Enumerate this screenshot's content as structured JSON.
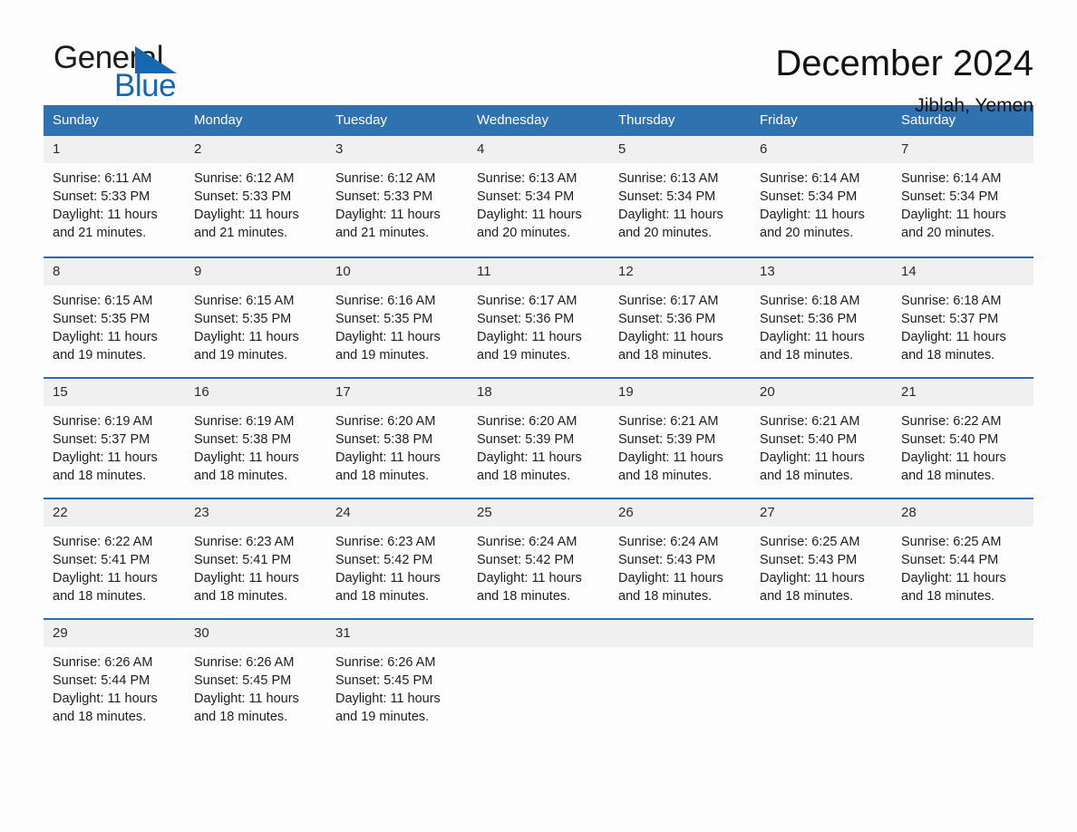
{
  "logo": {
    "word_one": "General",
    "word_two": "Blue",
    "accent_color": "#1668b3"
  },
  "header": {
    "month_title": "December 2024",
    "location": "Jiblah, Yemen",
    "header_bg_color": "#3071af",
    "row_divider_color": "#2a6cb0",
    "daynum_bg_color": "#f0f0f0"
  },
  "weekday_headers": [
    "Sunday",
    "Monday",
    "Tuesday",
    "Wednesday",
    "Thursday",
    "Friday",
    "Saturday"
  ],
  "weeks": [
    [
      {
        "day": "1",
        "sunrise": "Sunrise: 6:11 AM",
        "sunset": "Sunset: 5:33 PM",
        "daylight_line1": "Daylight: 11 hours",
        "daylight_line2": "and 21 minutes."
      },
      {
        "day": "2",
        "sunrise": "Sunrise: 6:12 AM",
        "sunset": "Sunset: 5:33 PM",
        "daylight_line1": "Daylight: 11 hours",
        "daylight_line2": "and 21 minutes."
      },
      {
        "day": "3",
        "sunrise": "Sunrise: 6:12 AM",
        "sunset": "Sunset: 5:33 PM",
        "daylight_line1": "Daylight: 11 hours",
        "daylight_line2": "and 21 minutes."
      },
      {
        "day": "4",
        "sunrise": "Sunrise: 6:13 AM",
        "sunset": "Sunset: 5:34 PM",
        "daylight_line1": "Daylight: 11 hours",
        "daylight_line2": "and 20 minutes."
      },
      {
        "day": "5",
        "sunrise": "Sunrise: 6:13 AM",
        "sunset": "Sunset: 5:34 PM",
        "daylight_line1": "Daylight: 11 hours",
        "daylight_line2": "and 20 minutes."
      },
      {
        "day": "6",
        "sunrise": "Sunrise: 6:14 AM",
        "sunset": "Sunset: 5:34 PM",
        "daylight_line1": "Daylight: 11 hours",
        "daylight_line2": "and 20 minutes."
      },
      {
        "day": "7",
        "sunrise": "Sunrise: 6:14 AM",
        "sunset": "Sunset: 5:34 PM",
        "daylight_line1": "Daylight: 11 hours",
        "daylight_line2": "and 20 minutes."
      }
    ],
    [
      {
        "day": "8",
        "sunrise": "Sunrise: 6:15 AM",
        "sunset": "Sunset: 5:35 PM",
        "daylight_line1": "Daylight: 11 hours",
        "daylight_line2": "and 19 minutes."
      },
      {
        "day": "9",
        "sunrise": "Sunrise: 6:15 AM",
        "sunset": "Sunset: 5:35 PM",
        "daylight_line1": "Daylight: 11 hours",
        "daylight_line2": "and 19 minutes."
      },
      {
        "day": "10",
        "sunrise": "Sunrise: 6:16 AM",
        "sunset": "Sunset: 5:35 PM",
        "daylight_line1": "Daylight: 11 hours",
        "daylight_line2": "and 19 minutes."
      },
      {
        "day": "11",
        "sunrise": "Sunrise: 6:17 AM",
        "sunset": "Sunset: 5:36 PM",
        "daylight_line1": "Daylight: 11 hours",
        "daylight_line2": "and 19 minutes."
      },
      {
        "day": "12",
        "sunrise": "Sunrise: 6:17 AM",
        "sunset": "Sunset: 5:36 PM",
        "daylight_line1": "Daylight: 11 hours",
        "daylight_line2": "and 18 minutes."
      },
      {
        "day": "13",
        "sunrise": "Sunrise: 6:18 AM",
        "sunset": "Sunset: 5:36 PM",
        "daylight_line1": "Daylight: 11 hours",
        "daylight_line2": "and 18 minutes."
      },
      {
        "day": "14",
        "sunrise": "Sunrise: 6:18 AM",
        "sunset": "Sunset: 5:37 PM",
        "daylight_line1": "Daylight: 11 hours",
        "daylight_line2": "and 18 minutes."
      }
    ],
    [
      {
        "day": "15",
        "sunrise": "Sunrise: 6:19 AM",
        "sunset": "Sunset: 5:37 PM",
        "daylight_line1": "Daylight: 11 hours",
        "daylight_line2": "and 18 minutes."
      },
      {
        "day": "16",
        "sunrise": "Sunrise: 6:19 AM",
        "sunset": "Sunset: 5:38 PM",
        "daylight_line1": "Daylight: 11 hours",
        "daylight_line2": "and 18 minutes."
      },
      {
        "day": "17",
        "sunrise": "Sunrise: 6:20 AM",
        "sunset": "Sunset: 5:38 PM",
        "daylight_line1": "Daylight: 11 hours",
        "daylight_line2": "and 18 minutes."
      },
      {
        "day": "18",
        "sunrise": "Sunrise: 6:20 AM",
        "sunset": "Sunset: 5:39 PM",
        "daylight_line1": "Daylight: 11 hours",
        "daylight_line2": "and 18 minutes."
      },
      {
        "day": "19",
        "sunrise": "Sunrise: 6:21 AM",
        "sunset": "Sunset: 5:39 PM",
        "daylight_line1": "Daylight: 11 hours",
        "daylight_line2": "and 18 minutes."
      },
      {
        "day": "20",
        "sunrise": "Sunrise: 6:21 AM",
        "sunset": "Sunset: 5:40 PM",
        "daylight_line1": "Daylight: 11 hours",
        "daylight_line2": "and 18 minutes."
      },
      {
        "day": "21",
        "sunrise": "Sunrise: 6:22 AM",
        "sunset": "Sunset: 5:40 PM",
        "daylight_line1": "Daylight: 11 hours",
        "daylight_line2": "and 18 minutes."
      }
    ],
    [
      {
        "day": "22",
        "sunrise": "Sunrise: 6:22 AM",
        "sunset": "Sunset: 5:41 PM",
        "daylight_line1": "Daylight: 11 hours",
        "daylight_line2": "and 18 minutes."
      },
      {
        "day": "23",
        "sunrise": "Sunrise: 6:23 AM",
        "sunset": "Sunset: 5:41 PM",
        "daylight_line1": "Daylight: 11 hours",
        "daylight_line2": "and 18 minutes."
      },
      {
        "day": "24",
        "sunrise": "Sunrise: 6:23 AM",
        "sunset": "Sunset: 5:42 PM",
        "daylight_line1": "Daylight: 11 hours",
        "daylight_line2": "and 18 minutes."
      },
      {
        "day": "25",
        "sunrise": "Sunrise: 6:24 AM",
        "sunset": "Sunset: 5:42 PM",
        "daylight_line1": "Daylight: 11 hours",
        "daylight_line2": "and 18 minutes."
      },
      {
        "day": "26",
        "sunrise": "Sunrise: 6:24 AM",
        "sunset": "Sunset: 5:43 PM",
        "daylight_line1": "Daylight: 11 hours",
        "daylight_line2": "and 18 minutes."
      },
      {
        "day": "27",
        "sunrise": "Sunrise: 6:25 AM",
        "sunset": "Sunset: 5:43 PM",
        "daylight_line1": "Daylight: 11 hours",
        "daylight_line2": "and 18 minutes."
      },
      {
        "day": "28",
        "sunrise": "Sunrise: 6:25 AM",
        "sunset": "Sunset: 5:44 PM",
        "daylight_line1": "Daylight: 11 hours",
        "daylight_line2": "and 18 minutes."
      }
    ],
    [
      {
        "day": "29",
        "sunrise": "Sunrise: 6:26 AM",
        "sunset": "Sunset: 5:44 PM",
        "daylight_line1": "Daylight: 11 hours",
        "daylight_line2": "and 18 minutes."
      },
      {
        "day": "30",
        "sunrise": "Sunrise: 6:26 AM",
        "sunset": "Sunset: 5:45 PM",
        "daylight_line1": "Daylight: 11 hours",
        "daylight_line2": "and 18 minutes."
      },
      {
        "day": "31",
        "sunrise": "Sunrise: 6:26 AM",
        "sunset": "Sunset: 5:45 PM",
        "daylight_line1": "Daylight: 11 hours",
        "daylight_line2": "and 19 minutes."
      },
      {
        "day": "",
        "sunrise": "",
        "sunset": "",
        "daylight_line1": "",
        "daylight_line2": ""
      },
      {
        "day": "",
        "sunrise": "",
        "sunset": "",
        "daylight_line1": "",
        "daylight_line2": ""
      },
      {
        "day": "",
        "sunrise": "",
        "sunset": "",
        "daylight_line1": "",
        "daylight_line2": ""
      },
      {
        "day": "",
        "sunrise": "",
        "sunset": "",
        "daylight_line1": "",
        "daylight_line2": ""
      }
    ]
  ]
}
